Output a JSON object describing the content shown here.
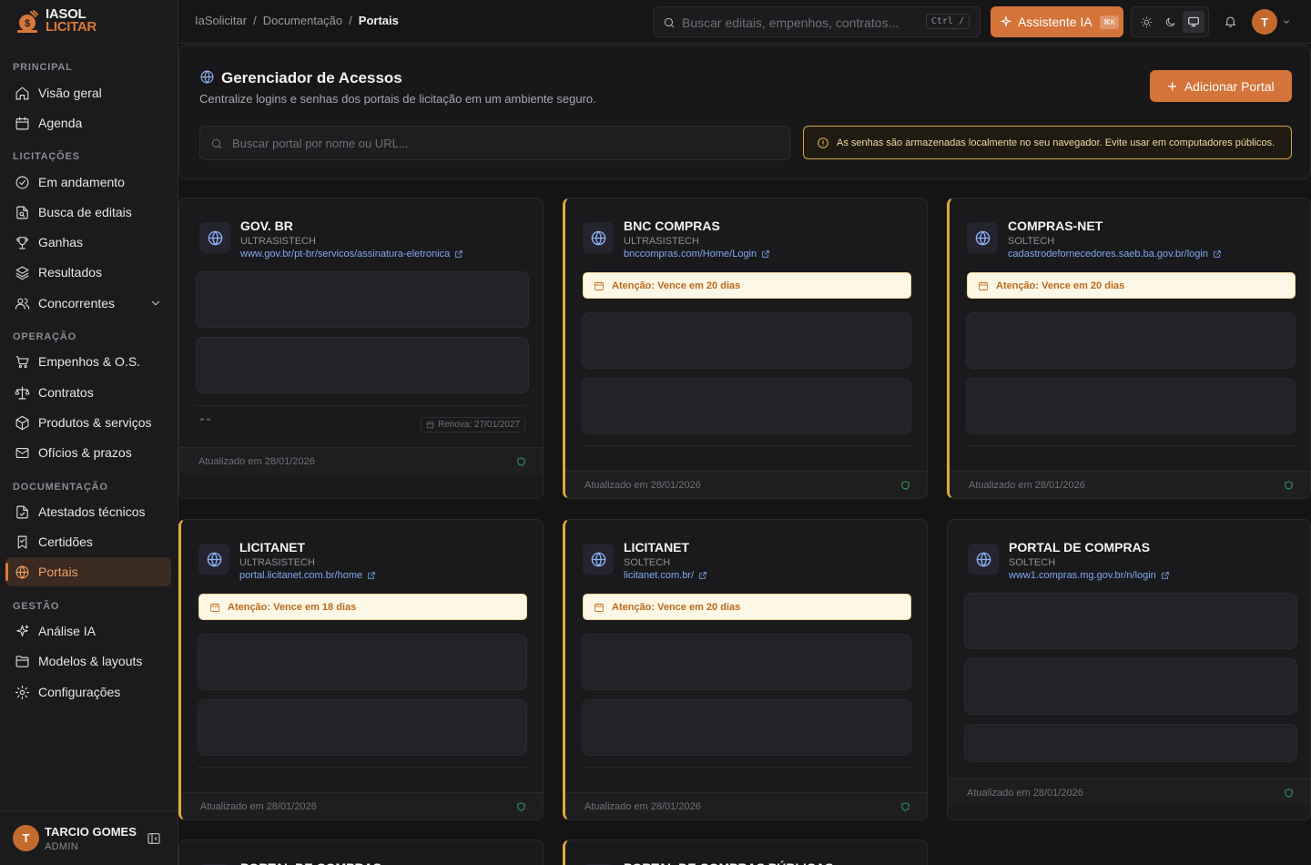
{
  "brand": {
    "line1": "IASOL",
    "line2": "LICITAR"
  },
  "sidebar": {
    "sections": [
      {
        "label": "PRINCIPAL",
        "items": [
          {
            "label": "Visão geral",
            "icon": "home-icon"
          },
          {
            "label": "Agenda",
            "icon": "calendar-icon"
          }
        ]
      },
      {
        "label": "LICITAÇÕES",
        "items": [
          {
            "label": "Em andamento",
            "icon": "check-circle-icon"
          },
          {
            "label": "Busca de editais",
            "icon": "file-search-icon"
          },
          {
            "label": "Ganhas",
            "icon": "trophy-icon"
          },
          {
            "label": "Resultados",
            "icon": "layers-icon"
          },
          {
            "label": "Concorrentes",
            "icon": "users-icon"
          }
        ]
      },
      {
        "label": "OPERAÇÃO",
        "items": [
          {
            "label": "Empenhos & O.S.",
            "icon": "cart-icon"
          },
          {
            "label": "Contratos",
            "icon": "scale-icon"
          },
          {
            "label": "Produtos & serviços",
            "icon": "package-icon"
          },
          {
            "label": "Ofícios & prazos",
            "icon": "mail-icon"
          }
        ]
      },
      {
        "label": "DOCUMENTAÇÃO",
        "items": [
          {
            "label": "Atestados técnicos",
            "icon": "file-check-icon"
          },
          {
            "label": "Certidões",
            "icon": "bookmark-check-icon"
          },
          {
            "label": "Portais",
            "icon": "globe-icon",
            "active": true
          }
        ]
      },
      {
        "label": "GESTÃO",
        "items": [
          {
            "label": "Análise IA",
            "icon": "sparkles-icon"
          },
          {
            "label": "Modelos & layouts",
            "icon": "folder-icon"
          },
          {
            "label": "Configurações",
            "icon": "gear-icon"
          }
        ]
      }
    ],
    "user": {
      "initial": "T",
      "name": "TARCIO GOMES",
      "role": "ADMIN"
    }
  },
  "topbar": {
    "breadcrumb": [
      "IaSolicitar",
      "Documentação",
      "Portais"
    ],
    "search_placeholder": "Buscar editais, empenhos, contratos...",
    "search_shortcut": "Ctrl /",
    "ai_button": "Assistente IA",
    "ai_badge": "⌘K",
    "avatar_initial": "T"
  },
  "page": {
    "title": "Gerenciador de Acessos",
    "subtitle": "Centralize logins e senhas dos portais de licitação em um ambiente seguro.",
    "add_button": "Adicionar Portal",
    "search_placeholder": "Buscar portal por nome ou URL...",
    "security_warning": "As senhas são armazenadas localmente no seu navegador. Evite usar em computadores públicos."
  },
  "cards": [
    {
      "name": "GOV. BR",
      "org": "ULTRASISTECH",
      "url": "www.gov.br/pt-br/servicos/assinatura-eletronica",
      "alert": "",
      "note": "\" \"",
      "renew": "Renova: 27/01/2027",
      "updated": "Atualizado em 28/01/2026"
    },
    {
      "name": "BNC COMPRAS",
      "org": "ULTRASISTECH",
      "url": "bnccompras.com/Home/Login",
      "alert": "Atenção: Vence em 20 dias",
      "updated": "Atualizado em 28/01/2026"
    },
    {
      "name": "COMPRAS-NET",
      "org": "SOLTECH",
      "url": "cadastrodefornecedores.saeb.ba.gov.br/login",
      "alert": "Atenção: Vence em 20 dias",
      "updated": "Atualizado em 28/01/2026"
    },
    {
      "name": "LICITANET",
      "org": "ULTRASISTECH",
      "url": "portal.licitanet.com.br/home",
      "alert": "Atenção: Vence em 18 dias",
      "updated": "Atualizado em 28/01/2026"
    },
    {
      "name": "LICITANET",
      "org": "SOLTECH",
      "url": "licitanet.com.br/",
      "alert": "Atenção: Vence em 20 dias",
      "updated": "Atualizado em 28/01/2026"
    },
    {
      "name": "PORTAL DE COMPRAS",
      "org": "SOLTECH",
      "url": "www1.compras.mg.gov.br/n/login",
      "alert": "",
      "updated": "Atualizado em 28/01/2026"
    },
    {
      "name": "PORTAL DE COMPRAS",
      "org": "",
      "url": "",
      "alert": ""
    },
    {
      "name": "PORTAL DE COMPRAS PÚBLICAS",
      "org": "",
      "url": "",
      "alert": ""
    }
  ],
  "colors": {
    "accent": "#d4733a",
    "warning": "#e3a93a",
    "link": "#7ea8f0"
  }
}
